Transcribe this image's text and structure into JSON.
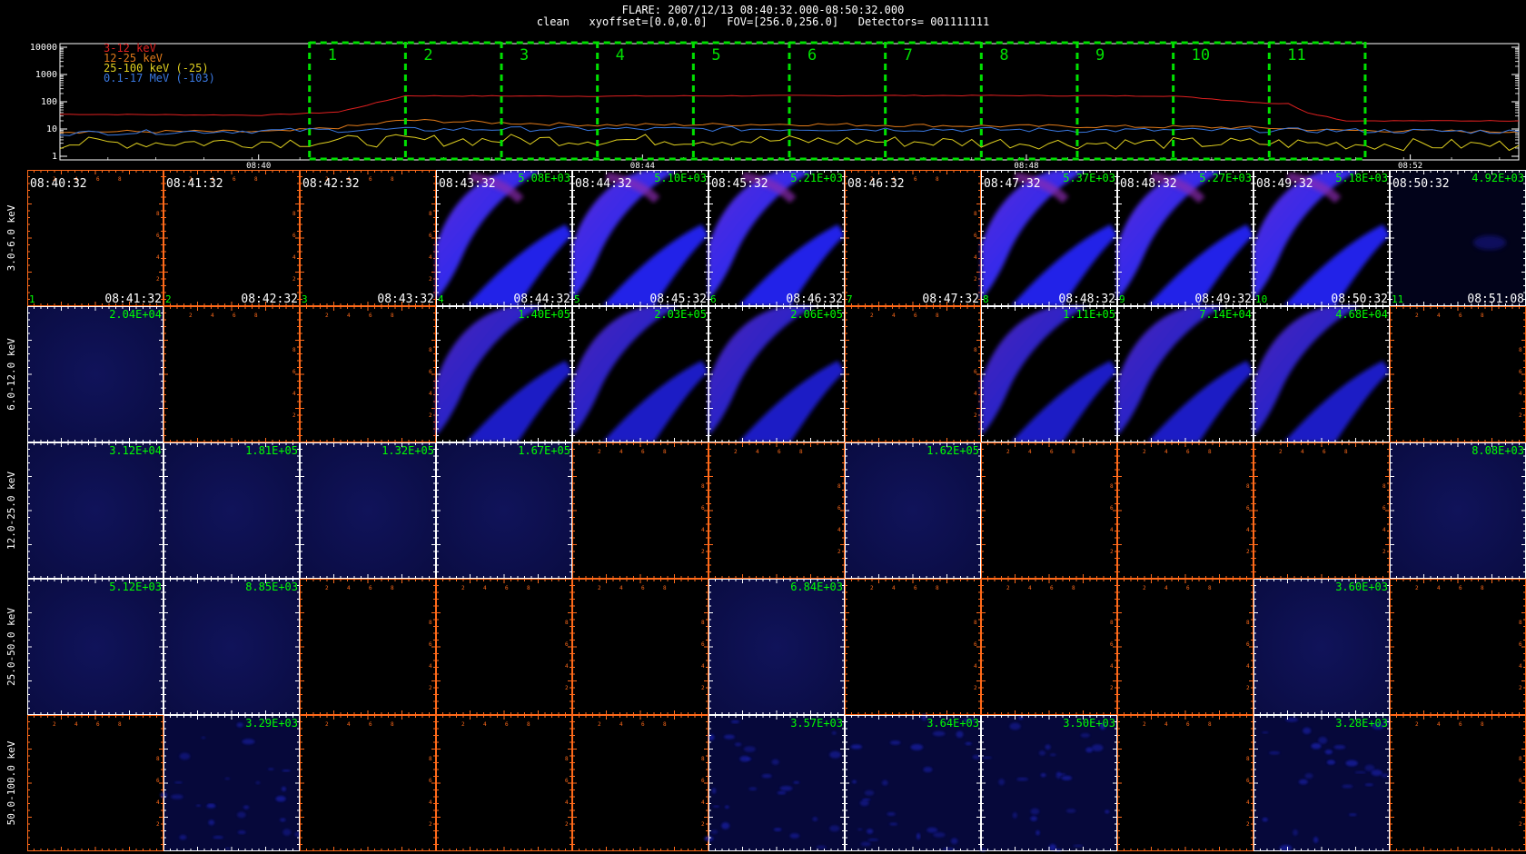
{
  "title": {
    "line1": "FLARE: 2007/12/13 08:40:32.000-08:50:32.000",
    "line2": "clean   xyoffset=[0.0,0.0]   FOV=[256.0,256.0]   Detectors= 001111111"
  },
  "chart_data": [
    {
      "type": "line",
      "yscale": "log",
      "ylim": [
        1,
        10000
      ],
      "y_ticks": [
        "10000",
        "1000",
        "100",
        "10",
        "1"
      ],
      "x_ticks": [
        "08:40",
        "08:44",
        "08:48",
        "08:52"
      ],
      "x_tick_minutes": [
        -0.53,
        3.47,
        7.47,
        11.47
      ],
      "xlim_minutes": [
        -2.6,
        12.6
      ],
      "legend_placement": "top-left",
      "colors": {
        "interval_boxes": "#00e000"
      },
      "series": [
        {
          "name": "3-12 keV",
          "color": "#e02020",
          "x_min": [
            -2.6,
            -0.5,
            0.3,
            0.6,
            1,
            3,
            5,
            7,
            9,
            10,
            10.2,
            10.4,
            10.8,
            12.6
          ],
          "y": [
            35,
            32,
            42,
            75,
            165,
            160,
            168,
            170,
            162,
            88,
            85,
            40,
            20,
            20
          ]
        },
        {
          "name": "12-25 keV",
          "color": "#e07a1a",
          "x_min": [
            -2.6,
            -0.3,
            0.5,
            1,
            1.7,
            3,
            5,
            7,
            9,
            10,
            10.3,
            10.6,
            12.6
          ],
          "y": [
            8,
            8,
            13,
            21,
            18,
            14,
            15,
            13,
            12,
            11,
            10,
            9,
            8
          ]
        },
        {
          "name": "25-100 keV (-25)",
          "color": "#e0d020",
          "x_min": [
            -2.6,
            0,
            2,
            4,
            6,
            8,
            10,
            12.6
          ],
          "y": [
            3,
            3.5,
            4,
            4,
            3.5,
            3,
            3,
            2.5
          ]
        },
        {
          "name": "0.1-17 MeV (-103)",
          "color": "#3a78e0",
          "x_min": [
            -2.6,
            0,
            2,
            4,
            6,
            8,
            10,
            12.6
          ],
          "y": [
            7,
            9,
            10,
            10,
            10,
            9,
            9,
            8
          ]
        }
      ],
      "intervals": [
        "1",
        "2",
        "3",
        "4",
        "5",
        "6",
        "7",
        "8",
        "9",
        "10",
        "11"
      ],
      "interval_start_minutes": [
        0,
        1,
        2,
        3,
        4,
        5,
        6,
        7,
        8,
        9,
        10
      ],
      "interval_end_minutes": 11
    },
    {
      "type": "heatmap",
      "rows": [
        "3.0-6.0 keV",
        "6.0-12.0 keV",
        "12.0-25.0 keV",
        "25.0-50.0 keV",
        "50.0-100.0 keV"
      ],
      "colors": {
        "frame_white": "#ffffff",
        "frame_orange": "#ff6a1a",
        "label": "#00ff00"
      },
      "time_start": [
        "08:40:32",
        "08:41:32",
        "08:42:32",
        "08:43:32",
        "08:44:32",
        "08:45:32",
        "08:46:32",
        "08:47:32",
        "08:48:32",
        "08:49:32",
        "08:50:32"
      ],
      "time_end": [
        "08:41:32",
        "08:42:32",
        "08:43:32",
        "08:44:32",
        "08:45:32",
        "08:46:32",
        "08:47:32",
        "08:48:32",
        "08:49:32",
        "08:50:32",
        "08:51:08"
      ],
      "interval_numbers": [
        "1",
        "2",
        "3",
        "4",
        "5",
        "6",
        "7",
        "8",
        "9",
        "10",
        "11"
      ],
      "peak_values": [
        [
          "",
          "",
          "",
          "5.08E+03",
          "5.10E+03",
          "5.21E+03",
          "",
          "5.37E+03",
          "5.27E+03",
          "5.18E+03",
          "4.92E+03"
        ],
        [
          "2.04E+04",
          "",
          "",
          "1.40E+05",
          "2.03E+05",
          "2.06E+05",
          "",
          "1.11E+05",
          "7.14E+04",
          "4.68E+04",
          ""
        ],
        [
          "3.12E+04",
          "1.81E+05",
          "1.32E+05",
          "1.67E+05",
          "",
          "",
          "1.62E+05",
          "",
          "",
          "",
          "8.08E+03"
        ],
        [
          "5.12E+03",
          "8.85E+03",
          "",
          "",
          "",
          "6.84E+03",
          "",
          "",
          "",
          "3.60E+03",
          ""
        ],
        [
          "",
          "3.29E+03",
          "",
          "",
          "",
          "3.57E+03",
          "3.64E+03",
          "3.50E+03",
          "",
          "3.28E+03",
          ""
        ]
      ],
      "image_type": [
        [
          "none",
          "none",
          "none",
          "flare",
          "flare",
          "flare",
          "none",
          "flare",
          "flare",
          "flare",
          "faint"
        ],
        [
          "fill",
          "none",
          "none",
          "flare",
          "flare",
          "flare",
          "none",
          "flare",
          "flare",
          "flare",
          "none"
        ],
        [
          "fill",
          "fill",
          "fill",
          "fill",
          "none",
          "none",
          "fill",
          "none",
          "none",
          "none",
          "fill"
        ],
        [
          "fill",
          "fill",
          "none",
          "none",
          "none",
          "fill",
          "none",
          "none",
          "none",
          "fill",
          "none"
        ],
        [
          "none",
          "noise",
          "none",
          "none",
          "none",
          "noise",
          "noise",
          "noise",
          "none",
          "noise",
          "none"
        ]
      ]
    }
  ]
}
